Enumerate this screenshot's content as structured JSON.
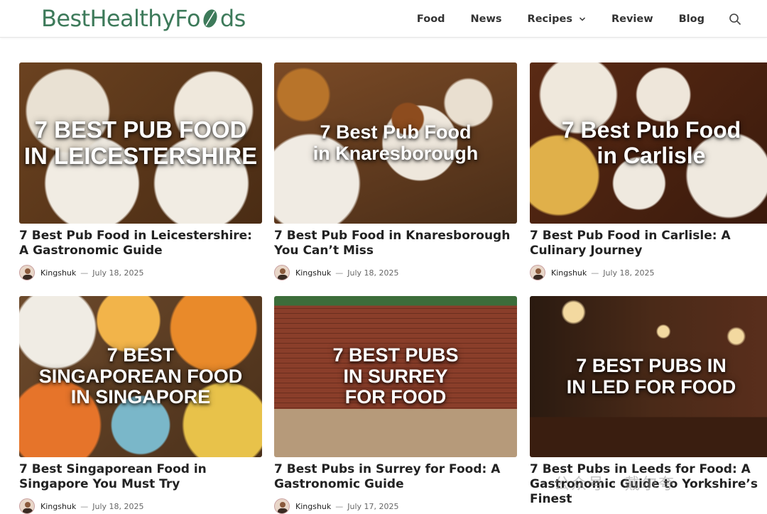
{
  "header": {
    "logo_before": "BestHealthyFo",
    "logo_after": "ds",
    "nav": [
      {
        "label": "Food"
      },
      {
        "label": "News"
      },
      {
        "label": "Recipes"
      },
      {
        "label": "Review"
      },
      {
        "label": "Blog"
      }
    ],
    "search_icon": "search-icon"
  },
  "cards": [
    {
      "overlay": [
        "7 BEST PUB FOOD",
        "IN LEICESTERSHIRE"
      ],
      "title": "7 Best Pub Food in Leicestershire: A Gastronomic Guide",
      "author": "Kingshuk",
      "date": "July 18, 2025"
    },
    {
      "overlay": [
        "7 Best Pub Food",
        "in Knaresborough"
      ],
      "title": "7 Best Pub Food in Knaresborough You Can’t Miss",
      "author": "Kingshuk",
      "date": "July 18, 2025"
    },
    {
      "overlay": [
        "7 Best Pub Food",
        "in Carlisle"
      ],
      "title": "7 Best Pub Food in Carlisle: A Culinary Journey",
      "author": "Kingshuk",
      "date": "July 18, 2025"
    },
    {
      "overlay": [
        "7 BEST",
        "SINGAPOREAN FOOD",
        "IN SINGAPORE"
      ],
      "title": "7 Best Singaporean Food in Singapore You Must Try",
      "author": "Kingshuk",
      "date": "July 18, 2025"
    },
    {
      "overlay": [
        "7 BEST PUBS",
        "IN SURREY",
        "FOR FOOD"
      ],
      "title": "7 Best Pubs in Surrey for Food: A Gastronomic Guide",
      "author": "Kingshuk",
      "date": "July 17, 2025"
    },
    {
      "overlay": [
        "7 BEST PUBS IN",
        "IN LED FOR FOOD"
      ],
      "title": "7 Best Pubs in Leeds for Food: A Gastronomic Guide to Yorkshire’s Finest",
      "author": "",
      "date": ""
    }
  ],
  "colors": {
    "brand": "#3d7a5a",
    "nav_text": "#333333",
    "title_text": "#222222"
  },
  "watermark": "公众号 · 戴尔夸"
}
